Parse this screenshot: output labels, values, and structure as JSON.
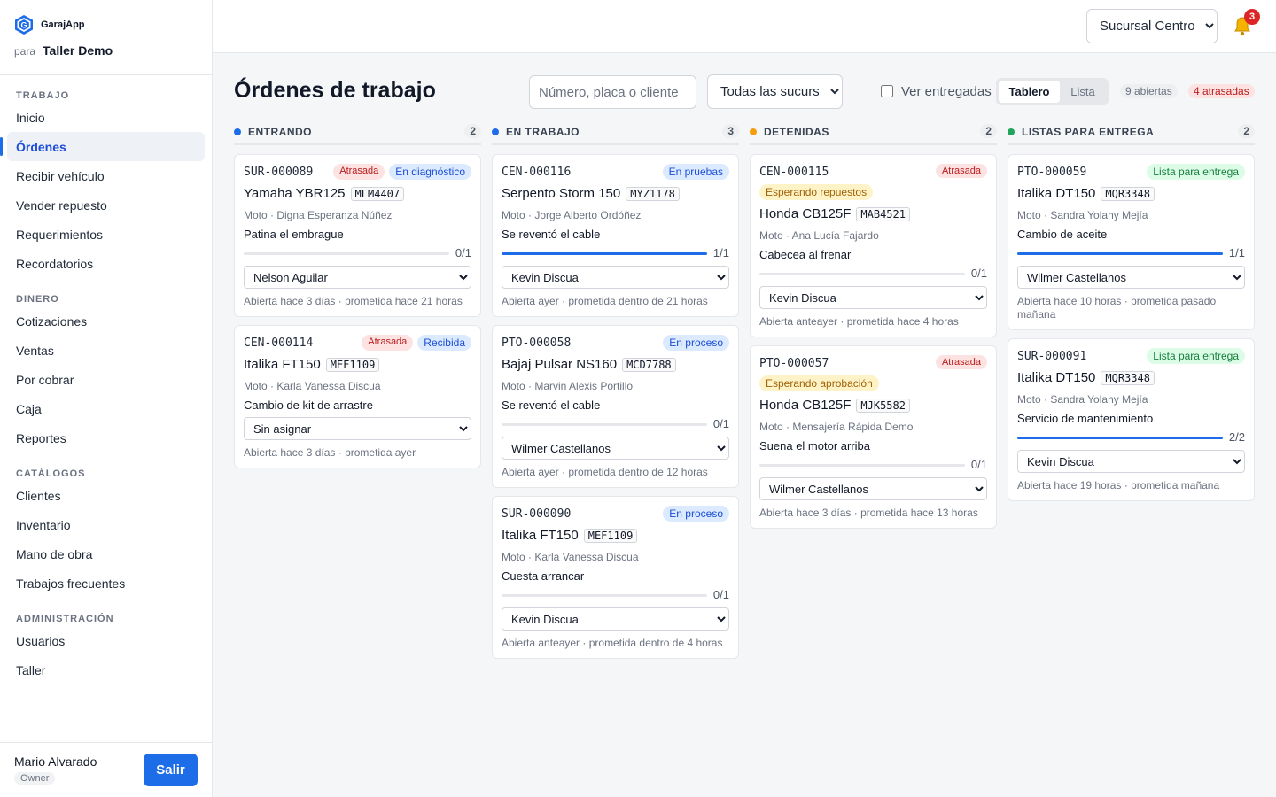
{
  "app": {
    "name": "GarajApp",
    "for_word": "para",
    "shop": "Taller Demo"
  },
  "nav": {
    "sections": [
      {
        "title": "TRABAJO",
        "items": [
          "Inicio",
          "Órdenes",
          "Recibir vehículo",
          "Vender repuesto",
          "Requerimientos",
          "Recordatorios"
        ]
      },
      {
        "title": "DINERO",
        "items": [
          "Cotizaciones",
          "Ventas",
          "Por cobrar",
          "Caja",
          "Reportes"
        ]
      },
      {
        "title": "CATÁLOGOS",
        "items": [
          "Clientes",
          "Inventario",
          "Mano de obra",
          "Trabajos frecuentes"
        ]
      },
      {
        "title": "ADMINISTRACIÓN",
        "items": [
          "Usuarios",
          "Taller"
        ]
      }
    ],
    "active": "Órdenes"
  },
  "user": {
    "name": "Mario Alvarado",
    "role": "Owner",
    "logout": "Salir"
  },
  "topbar": {
    "branch": "Sucursal Centro",
    "notifications": "3"
  },
  "page": {
    "title": "Órdenes de trabajo",
    "search_placeholder": "Número, placa o cliente",
    "branch_filter": "Todas las sucursales",
    "show_delivered": "Ver entregadas",
    "view_board": "Tablero",
    "view_list": "Lista",
    "open_count": "9 abiertas",
    "late_count": "4 atrasadas"
  },
  "colors": {
    "accent": "#1d6ce8",
    "entrando": "#1d6ce8",
    "en_trabajo": "#1d6ce8",
    "detenidas": "#f59e0b",
    "listas": "#22a55a"
  },
  "columns": [
    {
      "title": "ENTRANDO",
      "count": "2",
      "cards": [
        {
          "code": "SUR-000089",
          "late": "Atrasada",
          "status": "En diagnóstico",
          "status_kind": "blue",
          "vehicle": "Yamaha YBR125",
          "plate": "MLM4407",
          "meta": "Moto · Digna Esperanza Núñez",
          "problem": "Patina el embrague",
          "progress": 0,
          "progress_text": "0/1",
          "assignee": "Nelson Aguilar",
          "footer": "Abierta hace 3 días · prometida hace 21 horas"
        },
        {
          "code": "CEN-000114",
          "late": "Atrasada",
          "status": "Recibida",
          "status_kind": "blue",
          "vehicle": "Italika FT150",
          "plate": "MEF1109",
          "meta": "Moto · Karla Vanessa Discua",
          "problem": "Cambio de kit de arrastre",
          "progress": null,
          "progress_text": "",
          "assignee": "Sin asignar",
          "footer": "Abierta hace 3 días · prometida ayer"
        }
      ]
    },
    {
      "title": "EN TRABAJO",
      "count": "3",
      "cards": [
        {
          "code": "CEN-000116",
          "late": "",
          "status": "En pruebas",
          "status_kind": "blue",
          "vehicle": "Serpento Storm 150",
          "plate": "MYZ1178",
          "meta": "Moto · Jorge Alberto Ordóñez",
          "problem": "Se reventó el cable",
          "progress": 1,
          "progress_text": "1/1",
          "assignee": "Kevin Discua",
          "footer": "Abierta ayer · prometida dentro de 21 horas"
        },
        {
          "code": "PTO-000058",
          "late": "",
          "status": "En proceso",
          "status_kind": "blue",
          "vehicle": "Bajaj Pulsar NS160",
          "plate": "MCD7788",
          "meta": "Moto · Marvin Alexis Portillo",
          "problem": "Se reventó el cable",
          "progress": 0,
          "progress_text": "0/1",
          "assignee": "Wilmer Castellanos",
          "footer": "Abierta ayer · prometida dentro de 12 horas"
        },
        {
          "code": "SUR-000090",
          "late": "",
          "status": "En proceso",
          "status_kind": "blue",
          "vehicle": "Italika FT150",
          "plate": "MEF1109",
          "meta": "Moto · Karla Vanessa Discua",
          "problem": "Cuesta arrancar",
          "progress": 0,
          "progress_text": "0/1",
          "assignee": "Kevin Discua",
          "footer": "Abierta anteayer · prometida dentro de 4 horas"
        }
      ]
    },
    {
      "title": "DETENIDAS",
      "count": "2",
      "cards": [
        {
          "code": "CEN-000115",
          "late": "Atrasada",
          "status": "Esperando repuestos",
          "status_kind": "yellow",
          "vehicle": "Honda CB125F",
          "plate": "MAB4521",
          "meta": "Moto · Ana Lucía Fajardo",
          "problem": "Cabecea al frenar",
          "progress": 0,
          "progress_text": "0/1",
          "assignee": "Kevin Discua",
          "footer": "Abierta anteayer · prometida hace 4 horas"
        },
        {
          "code": "PTO-000057",
          "late": "Atrasada",
          "status": "Esperando aprobación",
          "status_kind": "yellow",
          "vehicle": "Honda CB125F",
          "plate": "MJK5582",
          "meta": "Moto · Mensajería Rápida Demo",
          "problem": "Suena el motor arriba",
          "progress": 0,
          "progress_text": "0/1",
          "assignee": "Wilmer Castellanos",
          "footer": "Abierta hace 3 días · prometida hace 13 horas"
        }
      ]
    },
    {
      "title": "LISTAS PARA ENTREGA",
      "count": "2",
      "cards": [
        {
          "code": "PTO-000059",
          "late": "",
          "status": "Lista para entrega",
          "status_kind": "green",
          "vehicle": "Italika DT150",
          "plate": "MQR3348",
          "meta": "Moto · Sandra Yolany Mejía",
          "problem": "Cambio de aceite",
          "progress": 1,
          "progress_text": "1/1",
          "assignee": "Wilmer Castellanos",
          "footer": "Abierta hace 10 horas · prometida pasado mañana"
        },
        {
          "code": "SUR-000091",
          "late": "",
          "status": "Lista para entrega",
          "status_kind": "green",
          "vehicle": "Italika DT150",
          "plate": "MQR3348",
          "meta": "Moto · Sandra Yolany Mejía",
          "problem": "Servicio de mantenimiento",
          "progress": 1,
          "progress_text": "2/2",
          "assignee": "Kevin Discua",
          "footer": "Abierta hace 19 horas · prometida mañana"
        }
      ]
    }
  ]
}
